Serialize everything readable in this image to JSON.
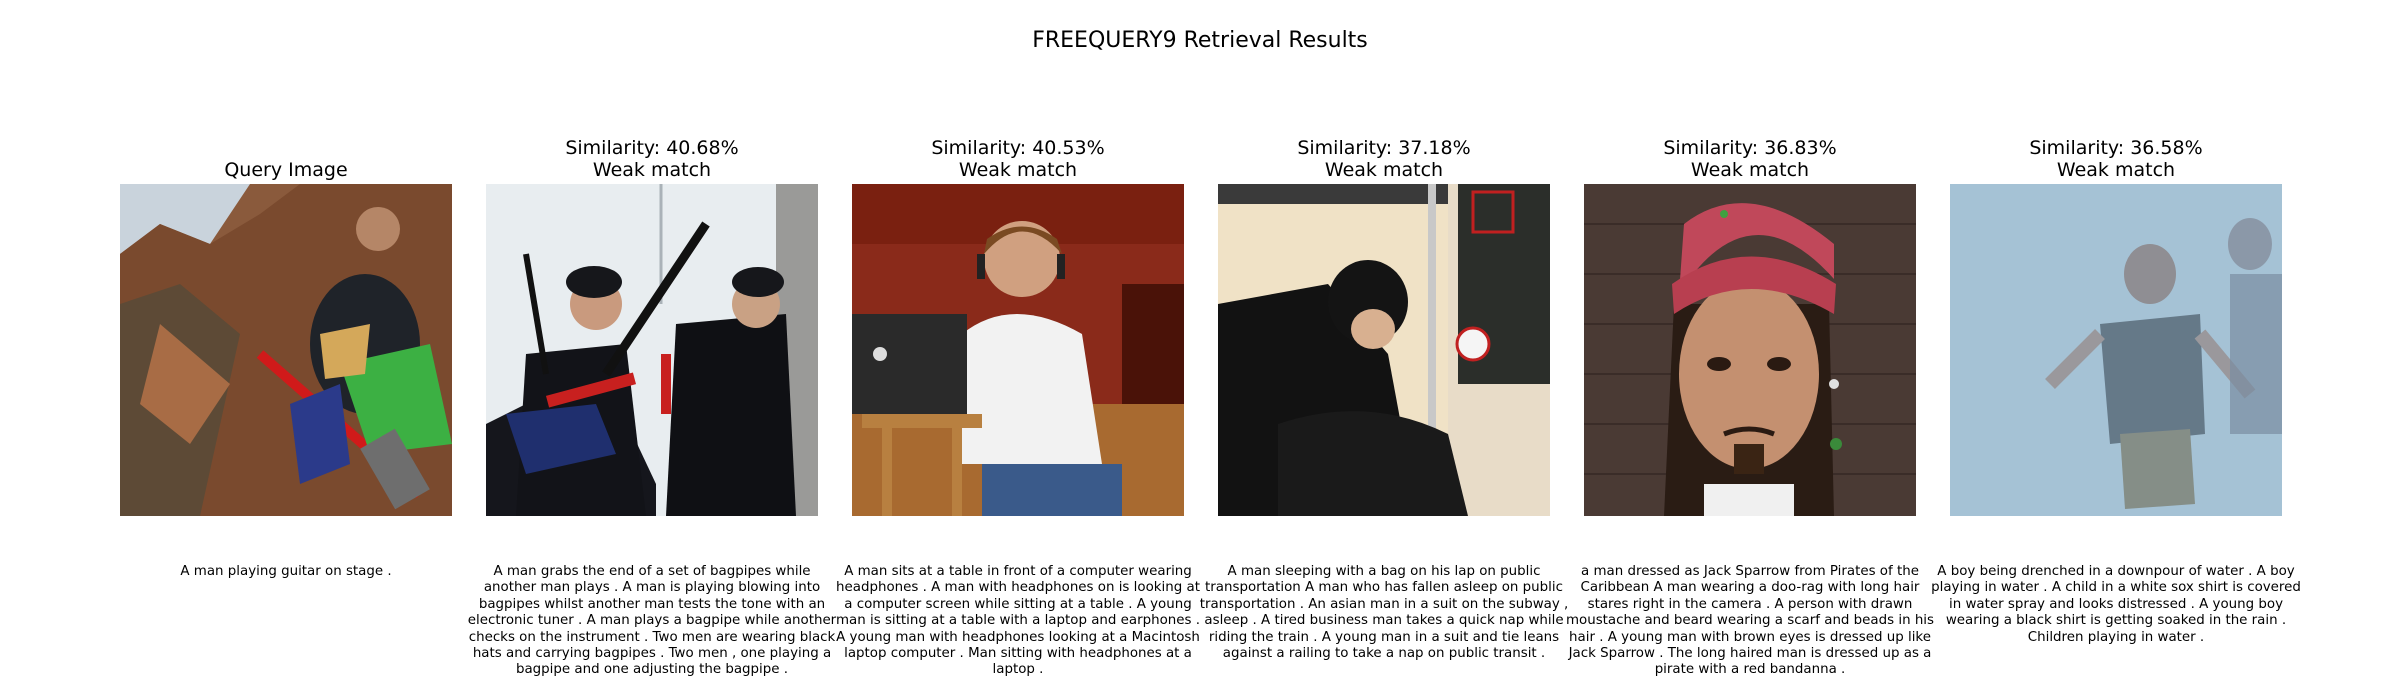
{
  "title": "FREEQUERY9 Retrieval Results",
  "query": {
    "label": "Query Image",
    "caption": "A man playing guitar on stage ."
  },
  "results": [
    {
      "similarity": "Similarity: 40.68%",
      "match": "Weak match",
      "caption": "A man grabs the end of a set of bagpipes while another man plays . A man is playing blowing into bagpipes whilst another man tests the tone with an electronic tuner . A man plays a bagpipe while another checks on the instrument . Two men are wearing black hats and carrying bagpipes . Two men , one playing a bagpipe and one adjusting the bagpipe ."
    },
    {
      "similarity": "Similarity: 40.53%",
      "match": "Weak match",
      "caption": "A man sits at a table in front of a computer wearing headphones . A man with headphones on is looking at a computer screen while sitting at a table . A young man is sitting at a table with a laptop and earphones . A young man with headphones looking at a Macintosh laptop computer . Man sitting with headphones at a laptop ."
    },
    {
      "similarity": "Similarity: 37.18%",
      "match": "Weak match",
      "caption": "A man sleeping with a bag on his lap on public transportation A man who has fallen asleep on public transportation . An asian man in a suit on the subway , asleep . A tired business man takes a quick nap while riding the train . A young man in a suit and tie leans against a railing to take a nap on public transit ."
    },
    {
      "similarity": "Similarity: 36.83%",
      "match": "Weak match",
      "caption": "a man dressed as Jack Sparrow from Pirates of the Caribbean A man wearing a doo-rag with long hair stares right in the camera . A person with drawn moustache and beard wearing a scarf and beads in his hair . A young man with brown eyes is dressed up like Jack Sparrow . The long haired man is dressed up as a pirate with a red bandanna ."
    },
    {
      "similarity": "Similarity: 36.58%",
      "match": "Weak match",
      "caption": "A boy being drenched in a downpour of water . A boy playing in water . A child in a white sox shirt is covered in water spray and looks distressed . A young boy wearing a black shirt is getting soaked in the rain . Children playing in water ."
    }
  ]
}
